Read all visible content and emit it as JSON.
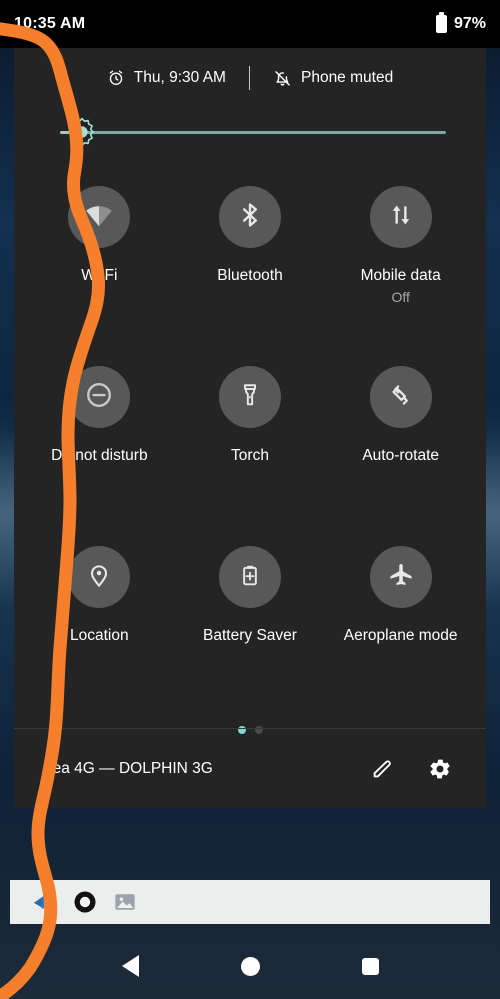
{
  "status_bar": {
    "time": "10:35 AM",
    "battery_percent": "97%",
    "battery_icon": "battery-icon"
  },
  "shade_header": {
    "alarm_icon": "alarm-clock-icon",
    "alarm_text": "Thu, 9:30 AM",
    "mute_icon": "bell-slash-icon",
    "mute_text": "Phone muted"
  },
  "brightness": {
    "label": "brightness-slider",
    "thumb_icon": "brightness-sun-icon",
    "value_percent": 4,
    "track_color": "#7fa8a4",
    "thumb_color": "#9fe0d8"
  },
  "tiles": [
    {
      "label": "Wi-Fi",
      "sublabel": "",
      "icon": "wifi-icon",
      "state": "off"
    },
    {
      "label": "Bluetooth",
      "sublabel": "",
      "icon": "bluetooth-icon",
      "state": "off"
    },
    {
      "label": "Mobile data",
      "sublabel": "Off",
      "icon": "mobile-data-icon",
      "state": "off"
    },
    {
      "label": "Do not disturb",
      "sublabel": "",
      "icon": "do-not-disturb-icon",
      "state": "off"
    },
    {
      "label": "Torch",
      "sublabel": "",
      "icon": "torch-icon",
      "state": "off"
    },
    {
      "label": "Auto-rotate",
      "sublabel": "",
      "icon": "auto-rotate-icon",
      "state": "off"
    },
    {
      "label": "Location",
      "sublabel": "",
      "icon": "location-pin-icon",
      "state": "off"
    },
    {
      "label": "Battery Saver",
      "sublabel": "",
      "icon": "battery-saver-icon",
      "state": "off"
    },
    {
      "label": "Aeroplane mode",
      "sublabel": "",
      "icon": "aeroplane-icon",
      "state": "off"
    }
  ],
  "pager": {
    "total_pages": 2,
    "active_page": 1,
    "active_color": "#7fd8d0",
    "inactive_color": "#4a4a4a"
  },
  "footer": {
    "carrier_text": "dea 4G — DOLPHIN 3G",
    "edit_icon": "pencil-edit-icon",
    "settings_icon": "gear-settings-icon"
  },
  "dock": {
    "items": [
      {
        "icon": "blue-arrow-icon"
      },
      {
        "icon": "camera-lens-icon"
      },
      {
        "icon": "photo-gallery-icon"
      }
    ]
  },
  "navigation_bar": {
    "back_icon": "back-triangle-icon",
    "home_icon": "home-circle-icon",
    "recents_icon": "recents-square-icon"
  },
  "annotation": {
    "stroke_color": "#f57f2a",
    "description": "hand-drawn-orange-line"
  }
}
